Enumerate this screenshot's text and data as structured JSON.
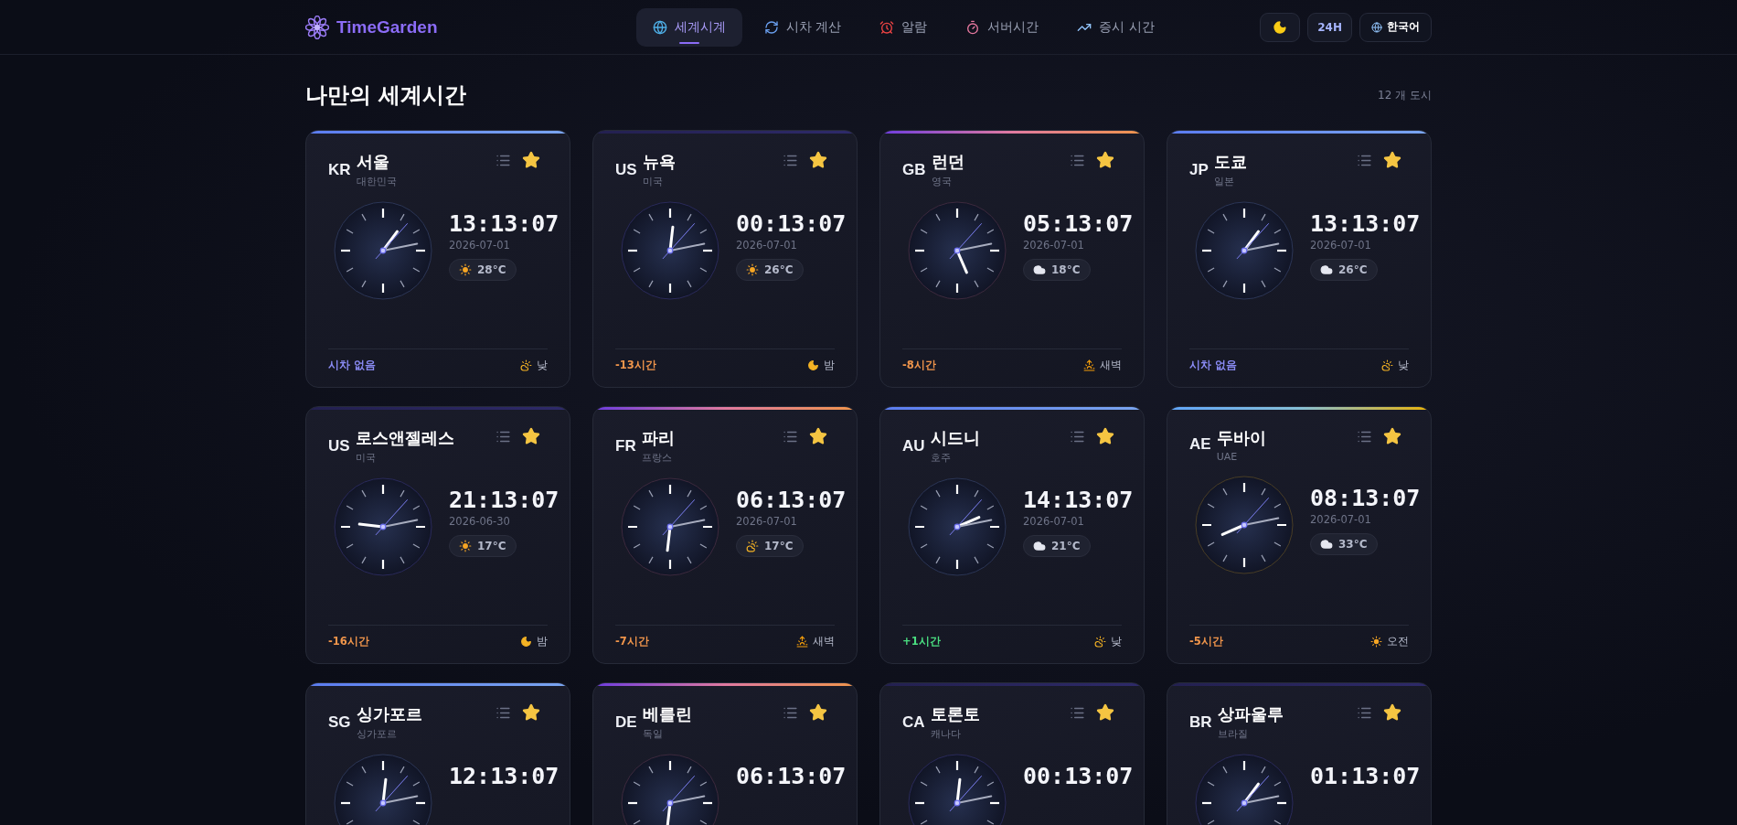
{
  "brand": {
    "name": "TimeGarden"
  },
  "nav": [
    {
      "label": "세계시계",
      "kind": "globe",
      "selected": true
    },
    {
      "label": "시차 계산",
      "kind": "convert",
      "selected": false
    },
    {
      "label": "알람",
      "kind": "alarm",
      "selected": false
    },
    {
      "label": "서버시간",
      "kind": "timer",
      "selected": false
    },
    {
      "label": "증시 시간",
      "kind": "chart",
      "selected": false
    }
  ],
  "actions": {
    "format": "24H",
    "language": "한국어"
  },
  "section": {
    "title": "나만의 세계시간",
    "count": "12 개 도시"
  },
  "cards": [
    {
      "code": "KR",
      "city": "서울",
      "country": "대한민국",
      "favorite": true,
      "kind": "day",
      "time": "13:13:07",
      "date": "2026-07-01",
      "weather": {
        "kind": "sun",
        "temp": "28°C"
      },
      "offset": {
        "text": "시차 없음",
        "color": "#8b8cf6"
      },
      "period": {
        "kind": "day",
        "label": "낮"
      }
    },
    {
      "code": "US",
      "city": "뉴욕",
      "country": "미국",
      "favorite": true,
      "kind": "night",
      "time": "00:13:07",
      "date": "2026-07-01",
      "weather": {
        "kind": "sun",
        "temp": "26°C"
      },
      "offset": {
        "text": "-13시간",
        "color": "#f0954b"
      },
      "period": {
        "kind": "night",
        "label": "밤"
      }
    },
    {
      "code": "GB",
      "city": "런던",
      "country": "영국",
      "favorite": true,
      "kind": "dawn",
      "time": "05:13:07",
      "date": "2026-07-01",
      "weather": {
        "kind": "cloud",
        "temp": "18°C"
      },
      "offset": {
        "text": "-8시간",
        "color": "#f0954b"
      },
      "period": {
        "kind": "dawn",
        "label": "새벽"
      }
    },
    {
      "code": "JP",
      "city": "도쿄",
      "country": "일본",
      "favorite": true,
      "kind": "day",
      "time": "13:13:07",
      "date": "2026-07-01",
      "weather": {
        "kind": "cloud",
        "temp": "26°C"
      },
      "offset": {
        "text": "시차 없음",
        "color": "#8b8cf6"
      },
      "period": {
        "kind": "day",
        "label": "낮"
      }
    },
    {
      "code": "US",
      "city": "로스앤젤레스",
      "country": "미국",
      "favorite": true,
      "kind": "night",
      "time": "21:13:07",
      "date": "2026-06-30",
      "weather": {
        "kind": "sun",
        "temp": "17°C"
      },
      "offset": {
        "text": "-16시간",
        "color": "#f0954b"
      },
      "period": {
        "kind": "night",
        "label": "밤"
      }
    },
    {
      "code": "FR",
      "city": "파리",
      "country": "프랑스",
      "favorite": true,
      "kind": "dawn",
      "time": "06:13:07",
      "date": "2026-07-01",
      "weather": {
        "kind": "partly",
        "temp": "17°C"
      },
      "offset": {
        "text": "-7시간",
        "color": "#f0954b"
      },
      "period": {
        "kind": "dawn",
        "label": "새벽"
      }
    },
    {
      "code": "AU",
      "city": "시드니",
      "country": "호주",
      "favorite": true,
      "kind": "day",
      "time": "14:13:07",
      "date": "2026-07-01",
      "weather": {
        "kind": "cloud",
        "temp": "21°C"
      },
      "offset": {
        "text": "+1시간",
        "color": "#4ade80"
      },
      "period": {
        "kind": "day",
        "label": "낮"
      }
    },
    {
      "code": "AE",
      "city": "두바이",
      "country": "UAE",
      "favorite": true,
      "kind": "morning",
      "time": "08:13:07",
      "date": "2026-07-01",
      "weather": {
        "kind": "cloud",
        "temp": "33°C"
      },
      "offset": {
        "text": "-5시간",
        "color": "#f0954b"
      },
      "period": {
        "kind": "morning",
        "label": "오전"
      }
    },
    {
      "code": "SG",
      "city": "싱가포르",
      "country": "싱가포르",
      "favorite": true,
      "kind": "day",
      "time": "12:13:07"
    },
    {
      "code": "DE",
      "city": "베를린",
      "country": "독일",
      "favorite": true,
      "kind": "dawn",
      "time": "06:13:07"
    },
    {
      "code": "CA",
      "city": "토론토",
      "country": "캐나다",
      "favorite": true,
      "kind": "night",
      "time": "00:13:07"
    },
    {
      "code": "BR",
      "city": "상파울루",
      "country": "브라질",
      "favorite": true,
      "kind": "night",
      "time": "01:13:07"
    }
  ]
}
